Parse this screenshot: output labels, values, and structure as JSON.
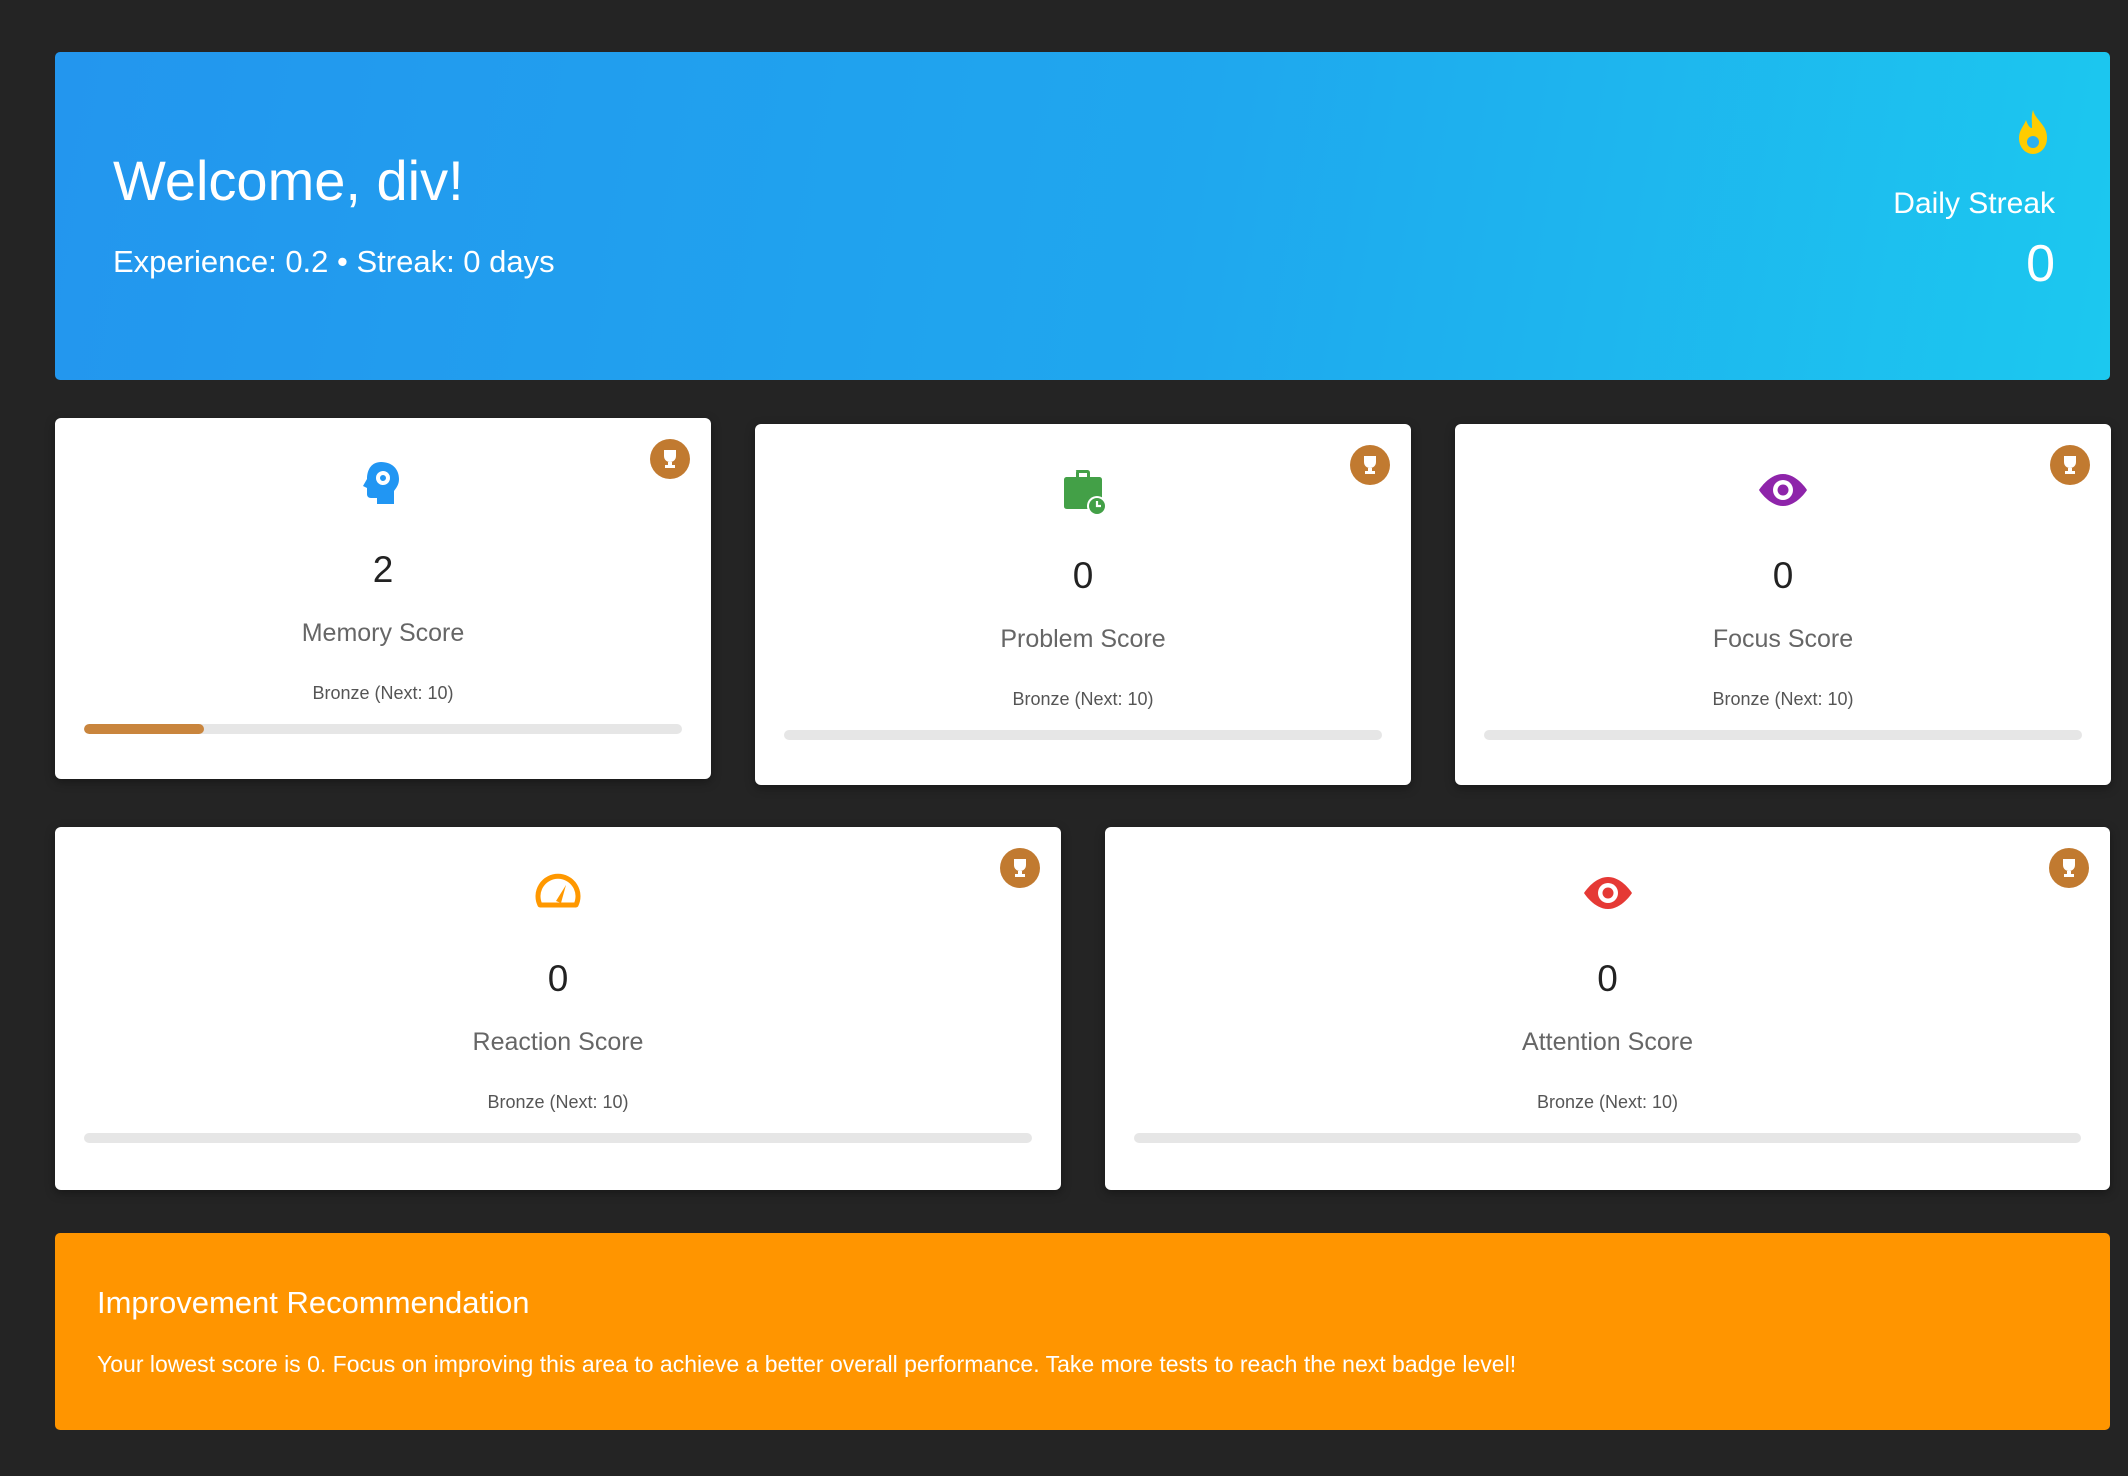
{
  "header": {
    "welcome_title": "Welcome, div!",
    "subtitle": "Experience: 0.2 • Streak: 0 days",
    "streak_label": "Daily Streak",
    "streak_value": "0",
    "streak_icon": "fire-icon"
  },
  "colors": {
    "banner_start": "#2396ee",
    "banner_end": "#1cc8ef",
    "background": "#242424",
    "trophy": "#c17a30",
    "progress": "#c9853d",
    "recommendation": "#ff9500",
    "memory_icon": "#2196f3",
    "problem_icon": "#43a047",
    "focus_icon": "#8e24aa",
    "reaction_icon": "#ff9800",
    "attention_icon": "#e53935"
  },
  "scores": {
    "memory": {
      "value": "2",
      "label": "Memory Score",
      "badge": "Bronze (Next: 10)",
      "progress": 0.2,
      "icon": "brain-gear-icon"
    },
    "problem": {
      "value": "0",
      "label": "Problem Score",
      "badge": "Bronze (Next: 10)",
      "progress": 0,
      "icon": "briefcase-clock-icon"
    },
    "focus": {
      "value": "0",
      "label": "Focus Score",
      "badge": "Bronze (Next: 10)",
      "progress": 0,
      "icon": "eye-icon"
    },
    "reaction": {
      "value": "0",
      "label": "Reaction Score",
      "badge": "Bronze (Next: 10)",
      "progress": 0,
      "icon": "speedometer-icon"
    },
    "attention": {
      "value": "0",
      "label": "Attention Score",
      "badge": "Bronze (Next: 10)",
      "progress": 0,
      "icon": "eye-icon"
    }
  },
  "recommendation": {
    "title": "Improvement Recommendation",
    "text": "Your lowest score is 0. Focus on improving this area to achieve a better overall performance. Take more tests to reach the next badge level!"
  }
}
